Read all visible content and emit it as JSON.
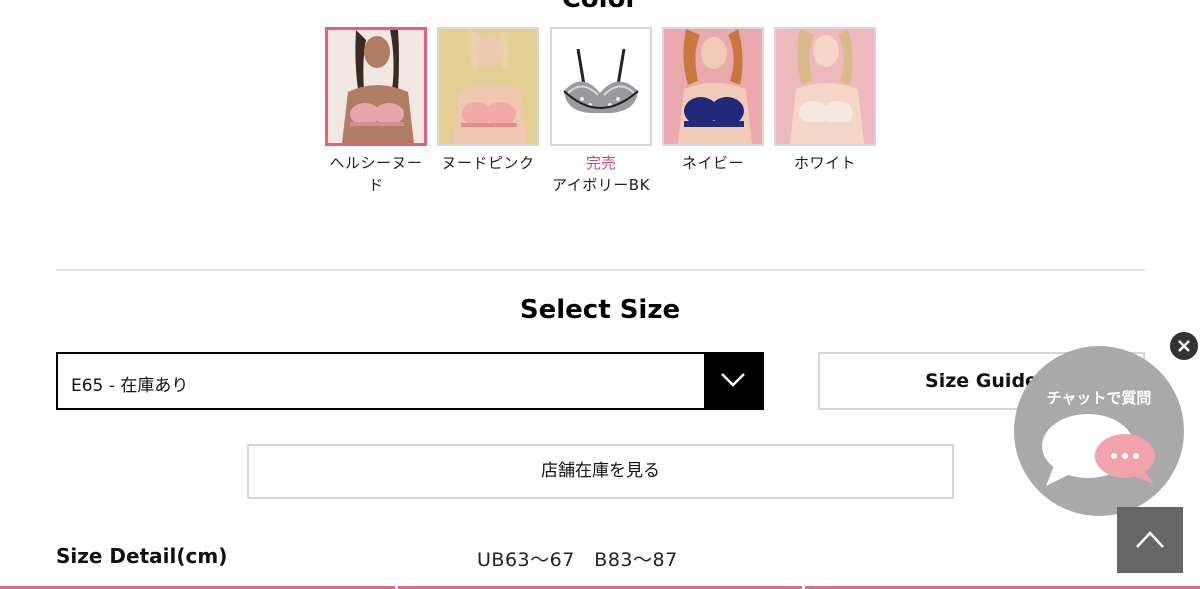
{
  "color_section": {
    "heading_partial": "Color",
    "swatches": [
      {
        "name": "ヘルシーヌード",
        "selected": true,
        "soldout_label": ""
      },
      {
        "name": "ヌードピンク",
        "selected": false,
        "soldout_label": ""
      },
      {
        "name": "アイボリーBK",
        "selected": false,
        "soldout_label": "完売"
      },
      {
        "name": "ネイビー",
        "selected": false,
        "soldout_label": ""
      },
      {
        "name": "ホワイト",
        "selected": false,
        "soldout_label": ""
      }
    ]
  },
  "size_section": {
    "title": "Select Size",
    "select_value": "E65 - 在庫あり",
    "size_guide_label": "Size Guide",
    "store_stock_label": "店舗在庫を見る",
    "detail_label": "Size Detail(cm)",
    "detail_value": "UB63〜67　B83〜87"
  },
  "chat": {
    "label": "チャットで質問"
  },
  "icons": {
    "dropdown": "chevron-down-icon",
    "close": "close-icon",
    "chat": "chat-bubble-icon",
    "back_to_top": "chevron-up-icon"
  },
  "colors": {
    "accent_pink": "#e6607a",
    "soldout_pink": "#d2467a",
    "chat_gray": "#a9a9a9",
    "chat_bubble_pink": "#f2a2ab",
    "back_to_top_gray": "#666666"
  }
}
